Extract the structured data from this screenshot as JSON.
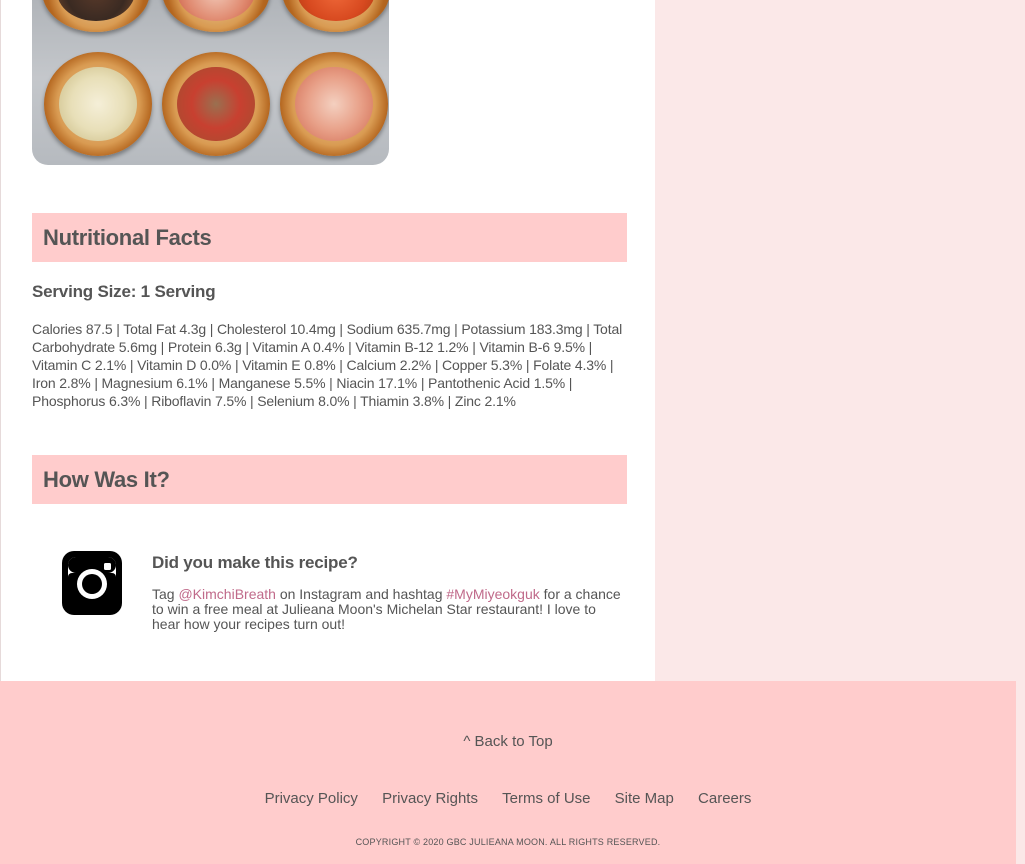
{
  "nutrition": {
    "heading": "Nutritional Facts",
    "serving_size": "Serving Size: 1 Serving",
    "details": "Calories 87.5 | Total Fat 4.3g | Cholesterol 10.4mg | Sodium 635.7mg | Potassium 183.3mg | Total Carbohydrate 5.6mg | Protein 6.3g | Vitamin A 0.4% | Vitamin B-12 1.2% | Vitamin B-6 9.5% | Vitamin C 2.1% | Vitamin D 0.0% | Vitamin E 0.8% | Calcium 2.2% | Copper 5.3% | Folate 4.3% | Iron 2.8% | Magnesium 6.1% | Manganese 5.5% | Niacin 17.1% | Pantothenic Acid 1.5% | Phosphorus 6.3% | Riboflavin 7.5% | Selenium 8.0% | Thiamin 3.8% | Zinc 2.1%"
  },
  "feedback": {
    "heading": "How Was It?",
    "title": "Did you make this recipe?",
    "text_tag": "Tag ",
    "handle": "@KimchiBreath",
    "text_mid": " on Instagram and hashtag ",
    "hashtag": "#MyMiyeokguk",
    "text_end": " for a chance to win a free meal at Julieana Moon's Michelan Star restaurant! I love to hear how your recipes turn out!",
    "icon": "instagram-icon"
  },
  "footer": {
    "back_to_top": "^ Back to Top",
    "links": [
      "Privacy Policy",
      "Privacy Rights",
      "Terms of Use",
      "Site Map",
      "Careers"
    ],
    "copyright": "COPYRIGHT © 2020 GBC JULIEANA MOON. ALL RIGHTS RESERVED."
  },
  "colors": {
    "accent_bar": "#ffcccc",
    "sidebar": "#fbe8e8",
    "link": "#c06a8a"
  }
}
